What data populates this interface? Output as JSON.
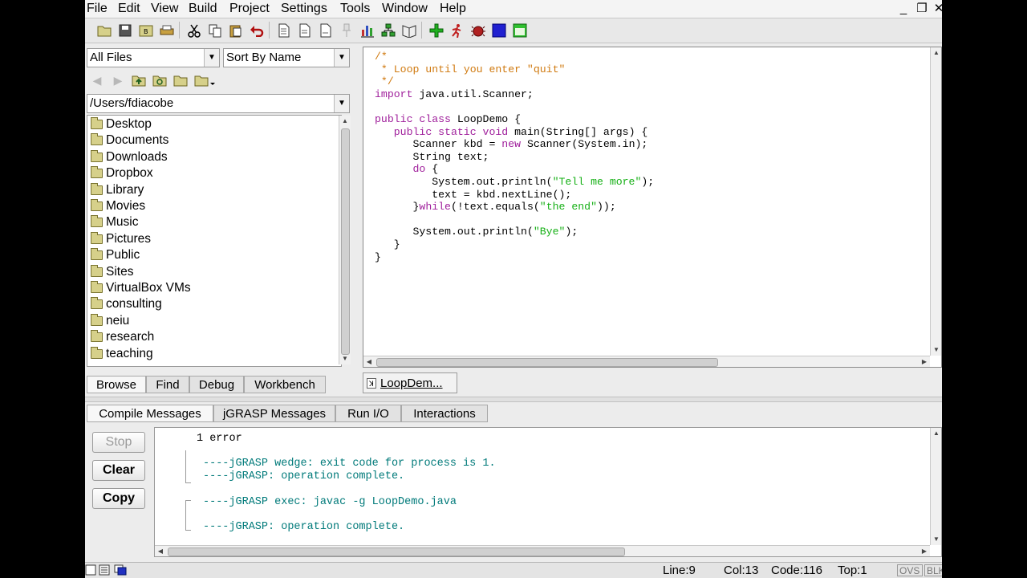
{
  "menu": [
    "File",
    "Edit",
    "View",
    "Build",
    "Project",
    "Settings",
    "Tools",
    "Window",
    "Help"
  ],
  "window_controls": {
    "minimize": "_",
    "restore": "❐",
    "close": "✕"
  },
  "toolbar": {
    "icons": [
      "open-folder-icon",
      "save-icon",
      "save-all-icon",
      "print-icon",
      "cut-icon",
      "copy-icon",
      "paste-icon",
      "undo-icon",
      "new-file-icon",
      "file-icon",
      "file-alt-icon",
      "pin-icon",
      "chart-icon",
      "tree-icon",
      "book-icon",
      "add-icon",
      "run-icon",
      "bug-icon",
      "stop-icon",
      "window-icon"
    ]
  },
  "browse": {
    "filter": "All Files",
    "sort": "Sort By Name",
    "path": "/Users/fdiacobe",
    "files": [
      "Desktop",
      "Documents",
      "Downloads",
      "Dropbox",
      "Library",
      "Movies",
      "Music",
      "Pictures",
      "Public",
      "Sites",
      "VirtualBox VMs",
      "consulting",
      "neiu",
      "research",
      "teaching"
    ],
    "tabs": [
      "Browse",
      "Find",
      "Debug",
      "Workbench"
    ]
  },
  "editor": {
    "doc_tab": "LoopDem...",
    "lines": [
      [
        {
          "t": "/*",
          "c": "comment"
        }
      ],
      [
        {
          "t": " * Loop until you enter \"quit\"",
          "c": "comment"
        }
      ],
      [
        {
          "t": " */",
          "c": "comment"
        }
      ],
      [
        {
          "t": "import",
          "c": "kw"
        },
        {
          "t": " java.util.Scanner;",
          "c": ""
        }
      ],
      [
        {
          "t": "",
          "c": ""
        }
      ],
      [
        {
          "t": "public class",
          "c": "kw"
        },
        {
          "t": " LoopDemo {",
          "c": ""
        }
      ],
      [
        {
          "t": "   ",
          "c": ""
        },
        {
          "t": "public static void",
          "c": "kw"
        },
        {
          "t": " main(String[] args) {",
          "c": ""
        }
      ],
      [
        {
          "t": "      Scanner kbd = ",
          "c": ""
        },
        {
          "t": "new",
          "c": "kw"
        },
        {
          "t": " Scanner(System.in);",
          "c": ""
        }
      ],
      [
        {
          "t": "      String text;",
          "c": ""
        }
      ],
      [
        {
          "t": "      ",
          "c": ""
        },
        {
          "t": "do",
          "c": "kw"
        },
        {
          "t": " {",
          "c": ""
        }
      ],
      [
        {
          "t": "         System.out.println(",
          "c": ""
        },
        {
          "t": "\"Tell me more\"",
          "c": "str"
        },
        {
          "t": ");",
          "c": ""
        }
      ],
      [
        {
          "t": "         text = kbd.nextLine();",
          "c": ""
        }
      ],
      [
        {
          "t": "      }",
          "c": ""
        },
        {
          "t": "while",
          "c": "kw"
        },
        {
          "t": "(!text.equals(",
          "c": ""
        },
        {
          "t": "\"the end\"",
          "c": "str"
        },
        {
          "t": "));",
          "c": ""
        }
      ],
      [
        {
          "t": "",
          "c": ""
        }
      ],
      [
        {
          "t": "      System.out.println(",
          "c": ""
        },
        {
          "t": "\"Bye\"",
          "c": "str"
        },
        {
          "t": ");",
          "c": ""
        }
      ],
      [
        {
          "t": "   }",
          "c": ""
        }
      ],
      [
        {
          "t": "}",
          "c": ""
        }
      ]
    ]
  },
  "messages": {
    "tabs": [
      "Compile Messages",
      "jGRASP Messages",
      "Run I/O",
      "Interactions"
    ],
    "buttons": {
      "stop": "Stop",
      "clear": "Clear",
      "copy": "Copy"
    },
    "lines": {
      "error": "1 error",
      "wedge": "----jGRASP wedge: exit code for process is 1.",
      "complete1": "----jGRASP: operation complete.",
      "exec": "----jGRASP exec: javac -g LoopDemo.java",
      "complete2": "----jGRASP: operation complete."
    }
  },
  "status": {
    "line": "Line:9",
    "col": "Col:13",
    "code": "Code:116",
    "top": "Top:1",
    "mode1": "OVS",
    "mode2": "BLK"
  },
  "colors": {
    "comment": "#d07a10",
    "keyword": "#a0209c",
    "string": "#16b016",
    "message": "#007a7a"
  }
}
